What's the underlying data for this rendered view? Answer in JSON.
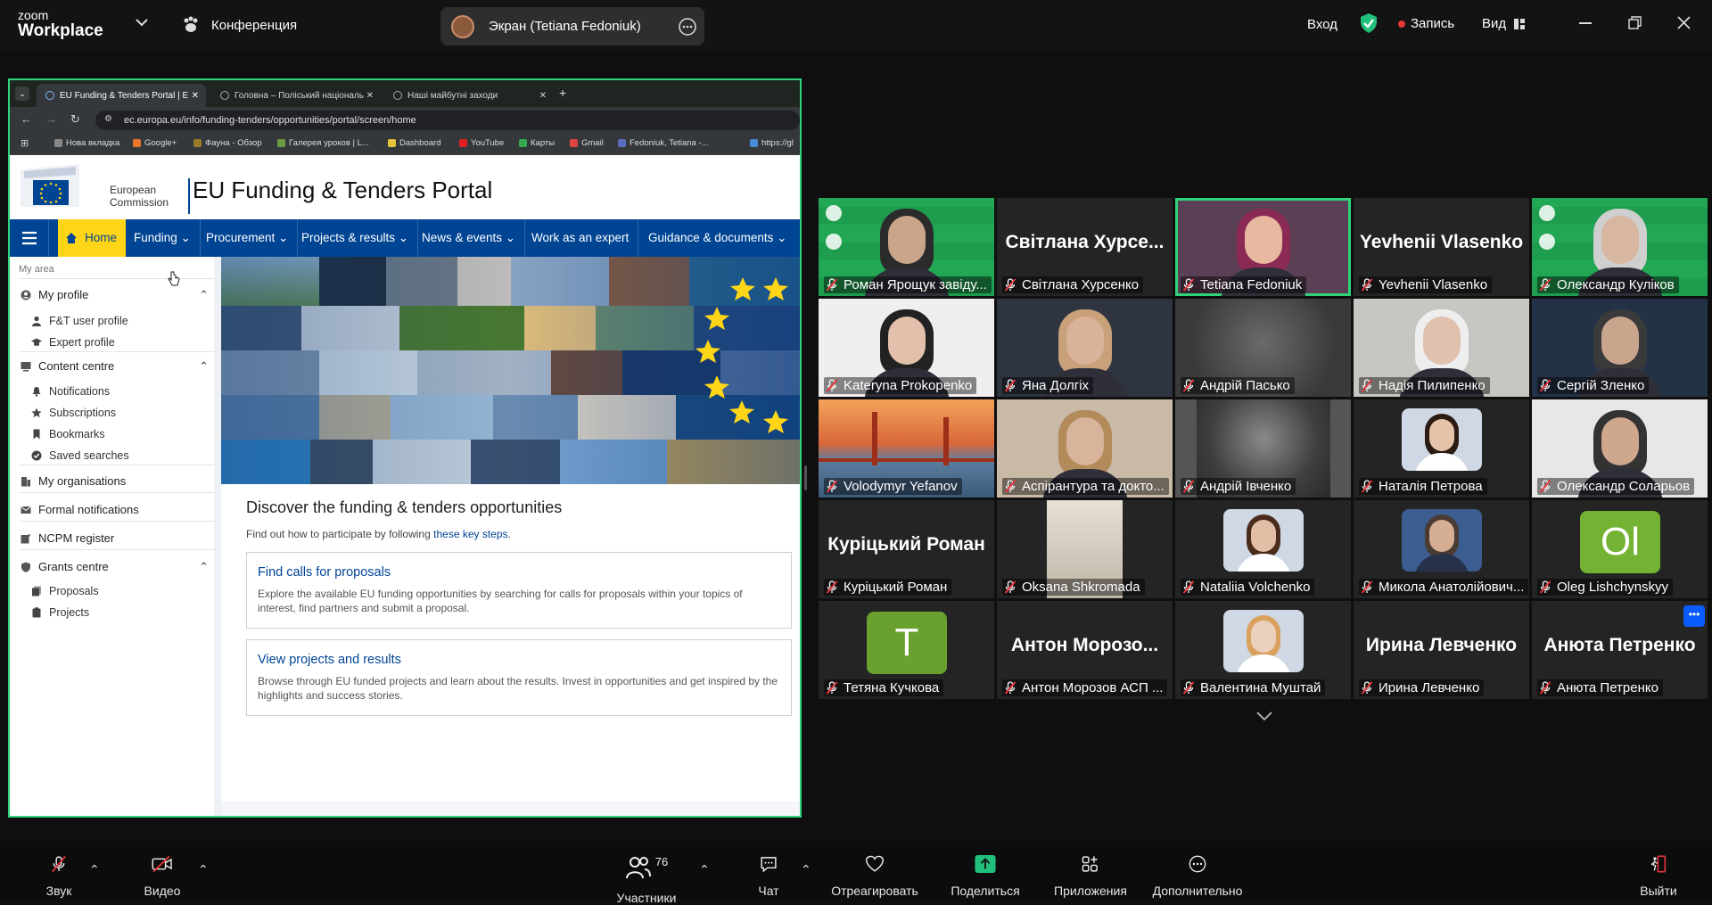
{
  "app": {
    "brand_top": "zoom",
    "brand_bottom": "Workplace",
    "conference_label": "Конференция",
    "share_pill": "Экран (Tetiana Fedoniuk)"
  },
  "topbar": {
    "signin": "Вход",
    "record": "Запись",
    "view": "Вид"
  },
  "toolbar": {
    "audio": "Звук",
    "video": "Видео",
    "participants": "Участники",
    "participants_count": "76",
    "chat": "Чат",
    "react": "Отреагировать",
    "share": "Поделиться",
    "apps": "Приложения",
    "more": "Дополнительно",
    "leave": "Выйти"
  },
  "browser": {
    "tabs": [
      "EU Funding & Tenders Portal | E",
      "Головна – Поліський національ",
      "Наші майбутні заходи"
    ],
    "url": "ec.europa.eu/info/funding-tenders/opportunities/portal/screen/home",
    "bookmarks": [
      "Нова вкладка",
      "Google+",
      "Фауна - Обзор",
      "Галерея уроков | L...",
      "Dashboard",
      "YouTube",
      "Карты",
      "Gmail",
      "Fedoniuk, Tetiana -...",
      "https://gl"
    ]
  },
  "portal": {
    "logo_line1": "European",
    "logo_line2": "Commission",
    "title": "EU Funding & Tenders Portal",
    "nav": [
      "Home",
      "Funding",
      "Procurement",
      "Projects & results",
      "News & events",
      "Work as an expert",
      "Guidance & documents"
    ],
    "sidebar": {
      "my_area": "My area",
      "my_profile": "My profile",
      "ft_user_profile": "F&T user profile",
      "expert_profile": "Expert profile",
      "content_centre": "Content centre",
      "notifications": "Notifications",
      "subscriptions": "Subscriptions",
      "bookmarks": "Bookmarks",
      "saved_searches": "Saved searches",
      "my_organisations": "My organisations",
      "formal_notifications": "Formal notifications",
      "ncpm_register": "NCPM register",
      "grants_centre": "Grants centre",
      "proposals": "Proposals",
      "projects": "Projects"
    },
    "discover_title": "Discover the funding & tenders opportunities",
    "discover_text": "Find out how to participate by following",
    "discover_link": "these key steps",
    "discover_end": ".",
    "card1_title": "Find calls for proposals",
    "card1_text": "Explore the available EU funding opportunities by searching for calls for proposals within your topics of interest, find partners and submit a proposal.",
    "card2_title": "View projects and results",
    "card2_text": "Browse through EU funded projects and learn about the results. Invest in opportunities and get inspired by the highlights and success stories."
  },
  "participants": [
    {
      "name": "Роман Ярощук завіду...",
      "big": ""
    },
    {
      "name": "Світлана Хурсенко",
      "big": "Світлана Хурсе..."
    },
    {
      "name": "Tetiana Fedoniuk",
      "big": ""
    },
    {
      "name": "Yevhenii Vlasenko",
      "big": "Yevhenii Vlasenko"
    },
    {
      "name": "Олександр Куліков",
      "big": ""
    },
    {
      "name": "Kateryna Prokopenko",
      "big": ""
    },
    {
      "name": "Яна Долгіх",
      "big": ""
    },
    {
      "name": "Андрій Пасько",
      "big": ""
    },
    {
      "name": "Надія Пилипенко",
      "big": ""
    },
    {
      "name": "Сергій Зленко",
      "big": ""
    },
    {
      "name": "Volodymyr Yefanov",
      "big": ""
    },
    {
      "name": "Аспірантура та докто...",
      "big": ""
    },
    {
      "name": "Андрій Івченко",
      "big": ""
    },
    {
      "name": "Наталія Петрова",
      "big": ""
    },
    {
      "name": "Олександр Соларьов",
      "big": ""
    },
    {
      "name": "Куріцький Роман",
      "big": "Куріцький Роман"
    },
    {
      "name": "Oksana Shkromada",
      "big": ""
    },
    {
      "name": "Nataliia Volchenko",
      "big": ""
    },
    {
      "name": "Микола Анатолійович...",
      "big": ""
    },
    {
      "name": "Oleg Lishchynskyy",
      "big": "Ol"
    },
    {
      "name": "Тетяна Кучкова",
      "big": "T"
    },
    {
      "name": "Антон Морозов АСП ...",
      "big": "Антон Морозо..."
    },
    {
      "name": "Валентина Муштай",
      "big": ""
    },
    {
      "name": "Ирина Левченко",
      "big": "Ирина Левченко"
    },
    {
      "name": "Анюта Петренко",
      "big": "Анюта Петренко"
    }
  ],
  "colors": {
    "accent_green": "#2fd37a",
    "ec_blue": "#004494",
    "home_yellow": "#ffd617",
    "mute_red": "#e5363b"
  }
}
